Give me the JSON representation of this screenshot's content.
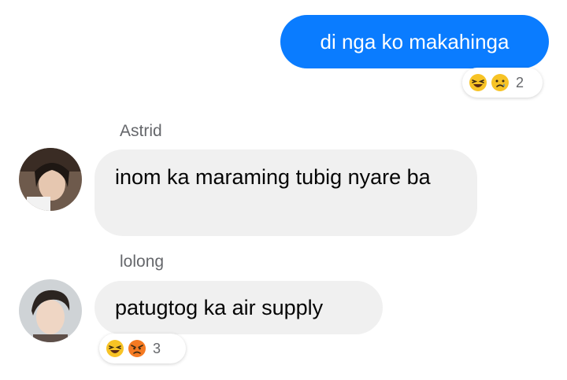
{
  "messages": {
    "outgoing": {
      "text": "di nga ko makahinga",
      "reactions": [
        "laughing-emoji",
        "crying-emoji"
      ],
      "reaction_count": "2"
    },
    "incoming": [
      {
        "sender": "Astrid",
        "text": "inom ka maraming tubig nyare ba"
      },
      {
        "sender": "lolong",
        "text": "patugtog ka air supply",
        "reactions": [
          "laughing-emoji",
          "angry-emoji"
        ],
        "reaction_count": "3"
      }
    ]
  },
  "colors": {
    "outgoing_bubble": "#0a7cff",
    "incoming_bubble": "#f0f0f0",
    "name_text": "#65676b"
  }
}
